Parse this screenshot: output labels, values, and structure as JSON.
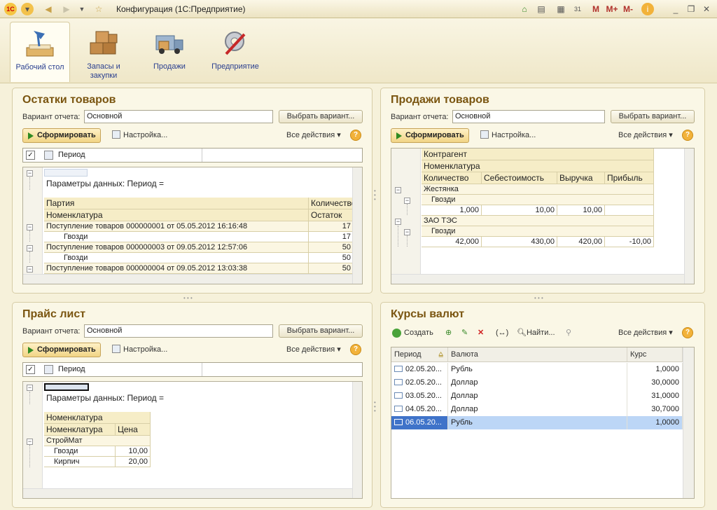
{
  "window": {
    "title": "Конфигурация  (1С:Предприятие)",
    "mem_buttons": [
      "M",
      "M+",
      "M-"
    ]
  },
  "nav": [
    {
      "label": "Рабочий стол",
      "icon": "desk-lamp-icon",
      "active": true
    },
    {
      "label": "Запасы и закупки",
      "icon": "boxes-icon"
    },
    {
      "label": "Продажи",
      "icon": "truck-icon"
    },
    {
      "label": "Предприятие",
      "icon": "gear-tools-icon"
    }
  ],
  "common": {
    "variant_label": "Вариант отчета:",
    "choose_variant": "Выбрать вариант...",
    "generate": "Сформировать",
    "settings": "Настройка...",
    "all_actions": "Все действия",
    "help": "?"
  },
  "stock": {
    "title": "Остатки товаров",
    "variant": "Основной",
    "period_label": "Период",
    "params": "Параметры данных:     Период =",
    "col_party": "Партия",
    "col_qty": "Количество",
    "col_item": "Номенклатура",
    "col_rest": "Остаток",
    "rows": [
      {
        "text": "Поступление товаров 000000001 от 05.05.2012 16:16:48",
        "val": "17",
        "group": true
      },
      {
        "text": "Гвозди",
        "val": "17",
        "group": false
      },
      {
        "text": "Поступление товаров 000000003 от 09.05.2012 12:57:06",
        "val": "50",
        "group": true
      },
      {
        "text": "Гвозди",
        "val": "50",
        "group": false
      },
      {
        "text": "Поступление товаров 000000004 от 09.05.2012 13:03:38",
        "val": "50",
        "group": true
      }
    ]
  },
  "sales": {
    "title": "Продажи товаров",
    "variant": "Основной",
    "col_contractor": "Контрагент",
    "col_item": "Номенклатура",
    "col_qty": "Количество",
    "col_cost": "Себестоимость",
    "col_revenue": "Выручка",
    "col_profit": "Прибыль",
    "groups": [
      {
        "name": "Жестянка",
        "item": "Гвозди",
        "qty": "1,000",
        "cost": "10,00",
        "revenue": "10,00",
        "profit": ""
      },
      {
        "name": "ЗАО ТЭС",
        "item": "Гвозди",
        "qty": "42,000",
        "cost": "430,00",
        "revenue": "420,00",
        "profit": "-10,00"
      }
    ]
  },
  "price": {
    "title": "Прайс лист",
    "variant": "Основной",
    "period_label": "Период",
    "params": "Параметры данных:     Период =",
    "col_item": "Номенклатура",
    "col_group": "Номенклатура",
    "col_price": "Цена",
    "group": "СтройМат",
    "items": [
      {
        "name": "Гвозди",
        "price": "10,00"
      },
      {
        "name": "Кирпич",
        "price": "20,00"
      }
    ]
  },
  "rates": {
    "title": "Курсы валют",
    "create": "Создать",
    "find": "Найти...",
    "col_period": "Период",
    "col_currency": "Валюта",
    "col_rate": "Курс",
    "rows": [
      {
        "date": "02.05.20...",
        "currency": "Рубль",
        "rate": "1,0000"
      },
      {
        "date": "02.05.20...",
        "currency": "Доллар",
        "rate": "30,0000"
      },
      {
        "date": "03.05.20...",
        "currency": "Доллар",
        "rate": "31,0000"
      },
      {
        "date": "04.05.20...",
        "currency": "Доллар",
        "rate": "30,7000"
      },
      {
        "date": "06.05.20...",
        "currency": "Рубль",
        "rate": "1,0000"
      }
    ]
  }
}
